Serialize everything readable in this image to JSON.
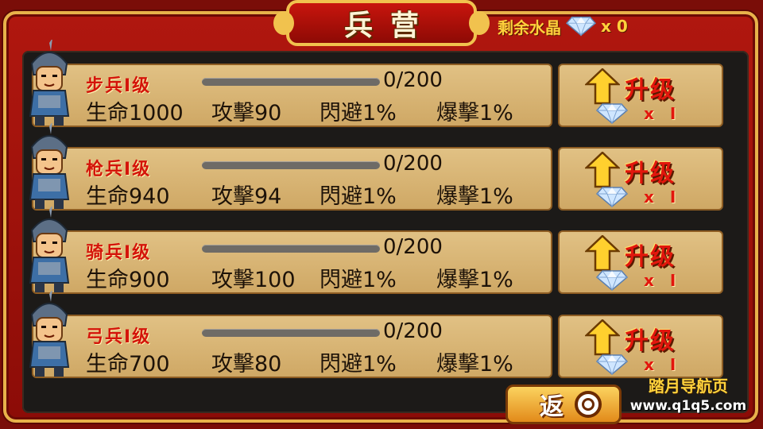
{
  "header": {
    "title": "兵营",
    "crystal_label": "剩余水晶",
    "crystal_count": "x 0"
  },
  "units": [
    {
      "name": "步兵Ⅰ级",
      "progress": "0/200",
      "progress_fraction": 0,
      "hp": "生命1000",
      "atk": "攻擊90",
      "dodge": "閃避1%",
      "crit": "爆擊1%",
      "upgrade_label": "升级",
      "cost_x": "x",
      "cost_n": "Ⅰ",
      "portrait": "infantry-soldier-icon"
    },
    {
      "name": "枪兵Ⅰ级",
      "progress": "0/200",
      "progress_fraction": 0,
      "hp": "生命940",
      "atk": "攻擊94",
      "dodge": "閃避1%",
      "crit": "爆擊1%",
      "upgrade_label": "升级",
      "cost_x": "x",
      "cost_n": "Ⅰ",
      "portrait": "spearman-soldier-icon"
    },
    {
      "name": "骑兵Ⅰ级",
      "progress": "0/200",
      "progress_fraction": 0,
      "hp": "生命900",
      "atk": "攻擊100",
      "dodge": "閃避1%",
      "crit": "爆擊1%",
      "upgrade_label": "升级",
      "cost_x": "x",
      "cost_n": "Ⅰ",
      "portrait": "cavalry-soldier-icon"
    },
    {
      "name": "弓兵Ⅰ级",
      "progress": "0/200",
      "progress_fraction": 0,
      "hp": "生命700",
      "atk": "攻擊80",
      "dodge": "閃避1%",
      "crit": "爆擊1%",
      "upgrade_label": "升级",
      "cost_x": "x",
      "cost_n": "Ⅰ",
      "portrait": "archer-soldier-icon"
    }
  ],
  "footer": {
    "back_label": "返",
    "watermark_line1": "踏月导航页",
    "watermark_line2": "www.q1q5.com"
  },
  "colors": {
    "frame_red": "#b0170f",
    "gold_trim": "#e8b24a",
    "panel_tan": "#d9b676",
    "accent_red": "#e2160d",
    "crystal_yellow": "#ffd23c"
  }
}
